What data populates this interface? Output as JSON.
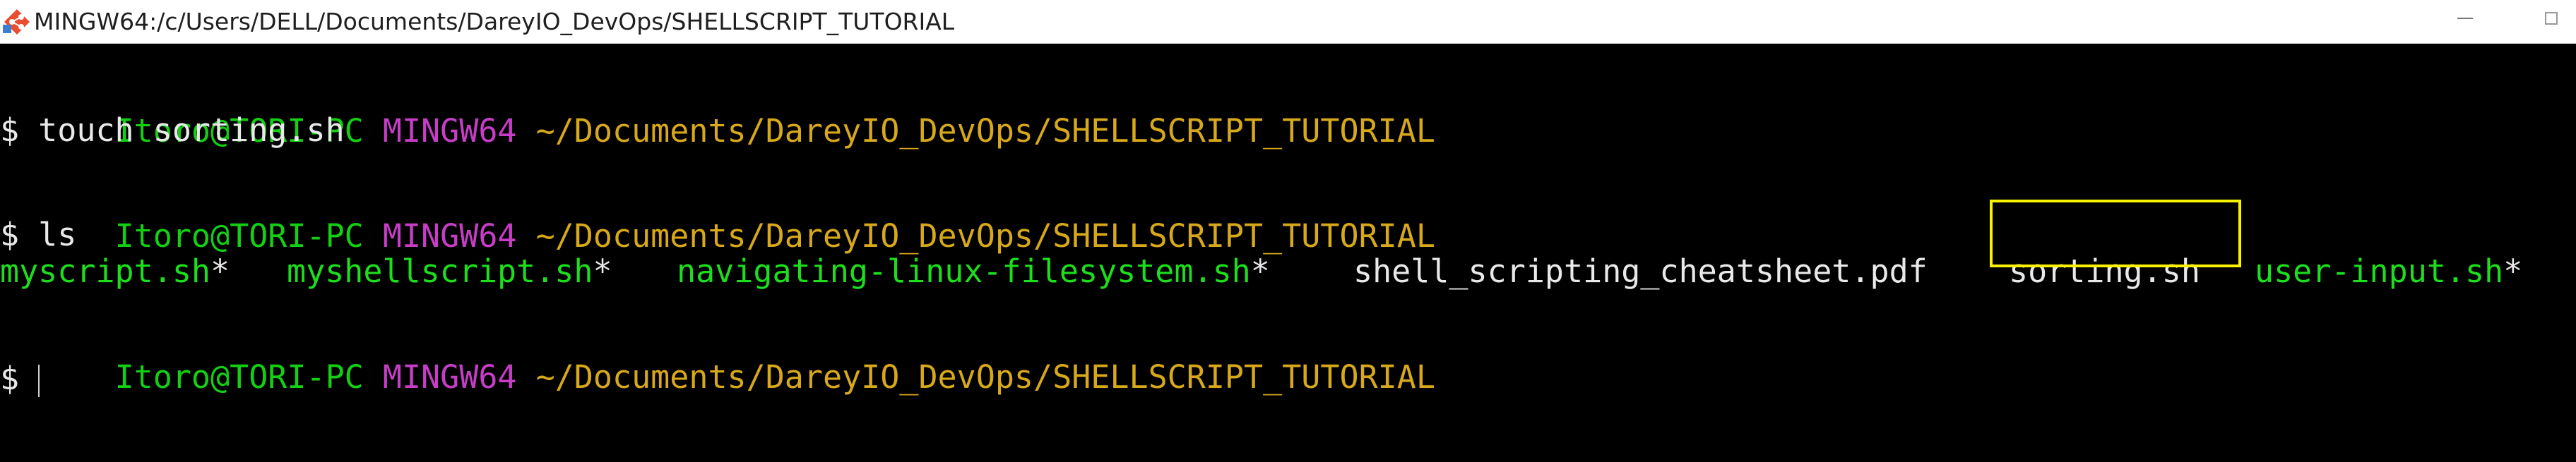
{
  "window": {
    "title": "MINGW64:/c/Users/DELL/Documents/DareyIO_DevOps/SHELLSCRIPT_TUTORIAL",
    "icon": "git-bash-icon",
    "controls": [
      "minimize-icon",
      "maximize-icon"
    ]
  },
  "colors": {
    "user_host": "#13d013",
    "env": "#c73dc7",
    "path": "#d7a81a",
    "executable": "#1dde1d",
    "highlight_box": "#f6f200"
  },
  "terminal": {
    "blocks": [
      {
        "user_host": "Itoro@TORI-PC",
        "env": "MINGW64",
        "path": "~/Documents/DareyIO_DevOps/SHELLSCRIPT_TUTORIAL",
        "command": "$ touch sorting.sh"
      },
      {
        "user_host": "Itoro@TORI-PC",
        "env": "MINGW64",
        "path": "~/Documents/DareyIO_DevOps/SHELLSCRIPT_TUTORIAL",
        "command": "$ ls"
      },
      {
        "user_host": "Itoro@TORI-PC",
        "env": "MINGW64",
        "path": "~/Documents/DareyIO_DevOps/SHELLSCRIPT_TUTORIAL",
        "command": "$ "
      }
    ],
    "ls_output": [
      {
        "name": "myscript.sh",
        "suffix": "*",
        "type": "executable"
      },
      {
        "name": "myshellscript.sh",
        "suffix": "*",
        "type": "executable"
      },
      {
        "name": "navigating-linux-filesystem.sh",
        "suffix": "*",
        "type": "executable"
      },
      {
        "name": "shell_scripting_cheatsheet.pdf",
        "suffix": "",
        "type": "file"
      },
      {
        "name": "sorting.sh",
        "suffix": "",
        "type": "file",
        "highlighted": true
      },
      {
        "name": "user-input.sh",
        "suffix": "*",
        "type": "executable"
      }
    ]
  }
}
